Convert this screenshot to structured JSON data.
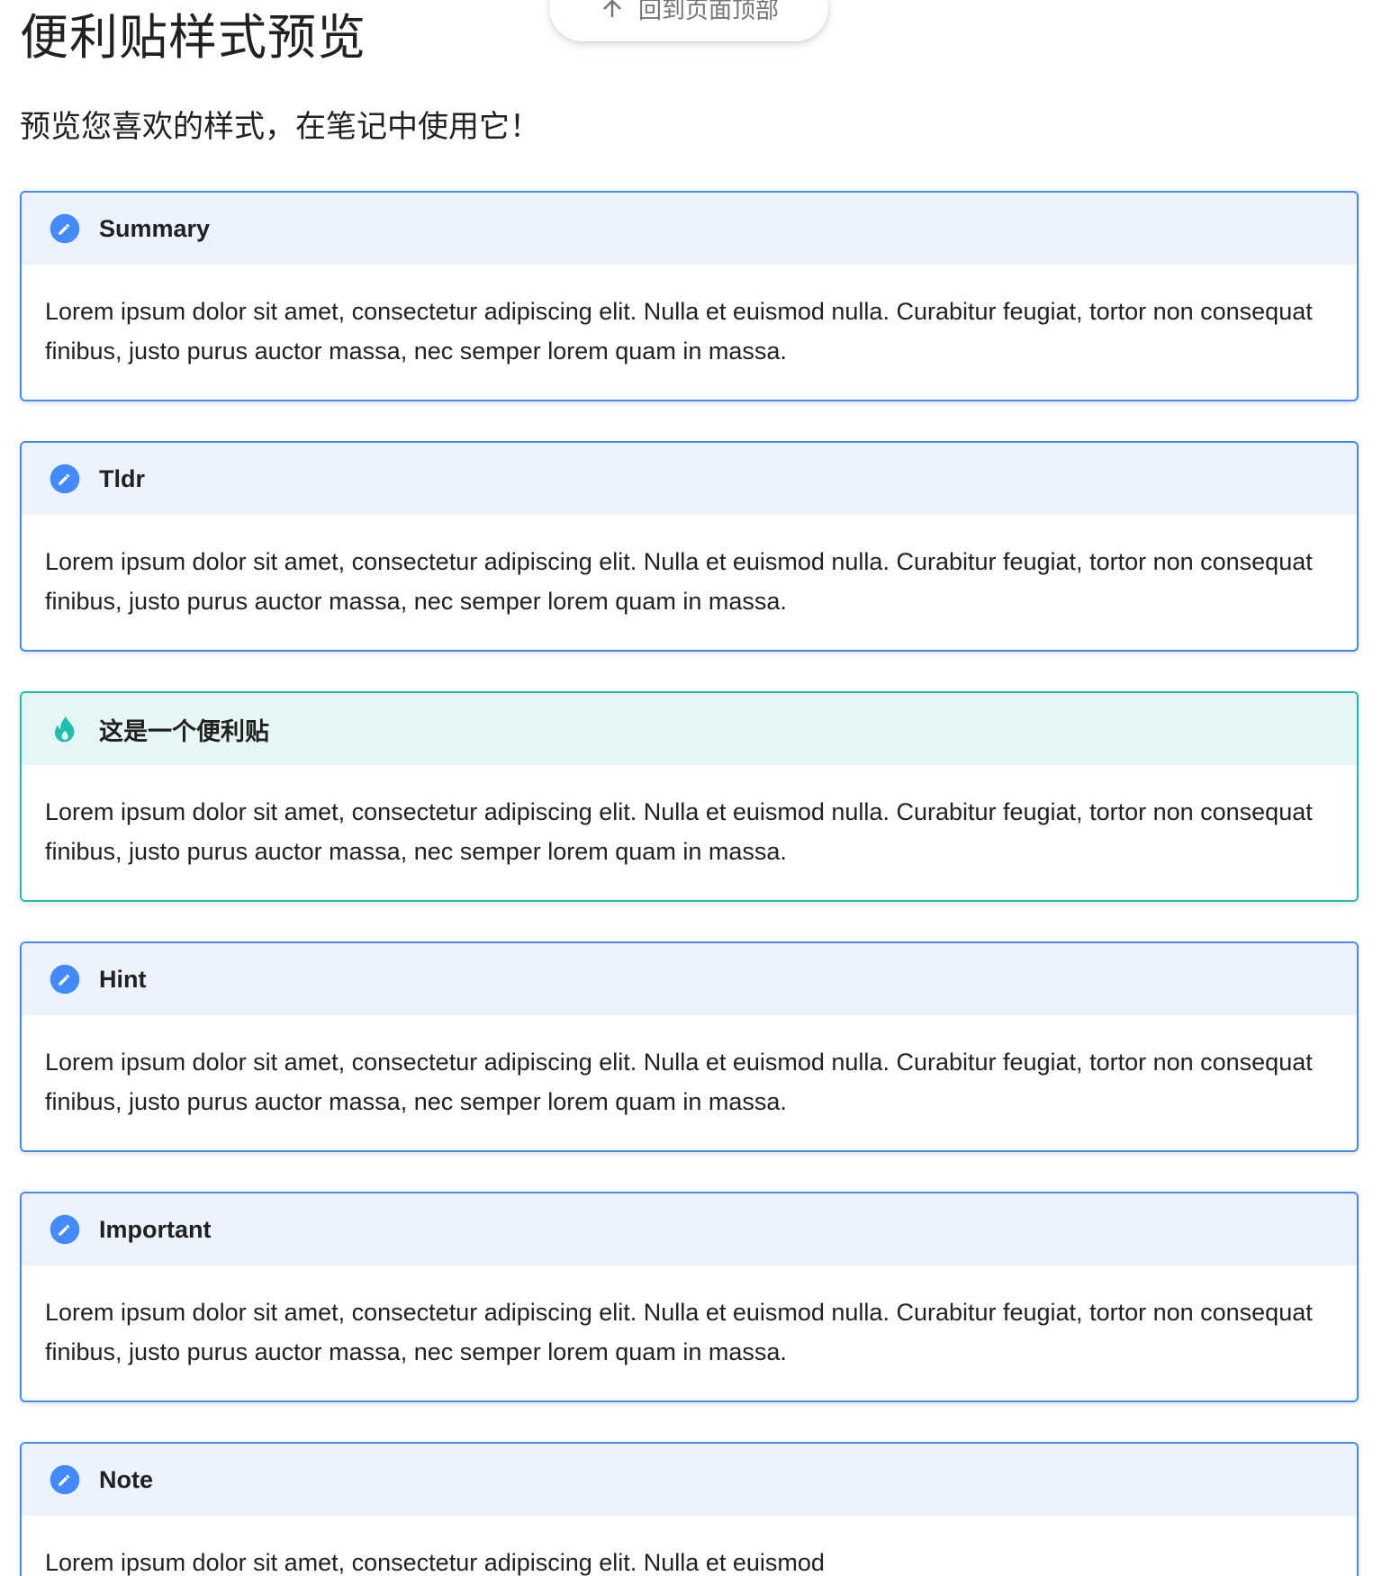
{
  "back_to_top": {
    "label": "回到页面顶部",
    "icon": "arrow-up-icon"
  },
  "header": {
    "title": "便利贴样式预览",
    "subtitle": "预览您喜欢的样式，在笔记中使用它！"
  },
  "colors": {
    "note_border": "#448aff",
    "note_header_bg": "#ecf3ff",
    "tip_border": "#1ebfae",
    "tip_header_bg": "#e5f7f4"
  },
  "admonitions": [
    {
      "type": "note",
      "icon": "pencil-icon",
      "title": "Summary",
      "body": "Lorem ipsum dolor sit amet, consectetur adipiscing elit. Nulla et euismod nulla. Curabitur feugiat, tortor non consequat finibus, justo purus auctor massa, nec semper lorem quam in massa."
    },
    {
      "type": "note",
      "icon": "pencil-icon",
      "title": "Tldr",
      "body": "Lorem ipsum dolor sit amet, consectetur adipiscing elit. Nulla et euismod nulla. Curabitur feugiat, tortor non consequat finibus, justo purus auctor massa, nec semper lorem quam in massa."
    },
    {
      "type": "tip",
      "icon": "flame-icon",
      "title": "这是一个便利贴",
      "body": "Lorem ipsum dolor sit amet, consectetur adipiscing elit. Nulla et euismod nulla. Curabitur feugiat, tortor non consequat finibus, justo purus auctor massa, nec semper lorem quam in massa."
    },
    {
      "type": "note",
      "icon": "pencil-icon",
      "title": "Hint",
      "body": "Lorem ipsum dolor sit amet, consectetur adipiscing elit. Nulla et euismod nulla. Curabitur feugiat, tortor non consequat finibus, justo purus auctor massa, nec semper lorem quam in massa."
    },
    {
      "type": "note",
      "icon": "pencil-icon",
      "title": "Important",
      "body": "Lorem ipsum dolor sit amet, consectetur adipiscing elit. Nulla et euismod nulla. Curabitur feugiat, tortor non consequat finibus, justo purus auctor massa, nec semper lorem quam in massa."
    },
    {
      "type": "note",
      "icon": "pencil-icon",
      "title": "Note",
      "body": "Lorem ipsum dolor sit amet, consectetur adipiscing elit. Nulla et euismod"
    }
  ]
}
